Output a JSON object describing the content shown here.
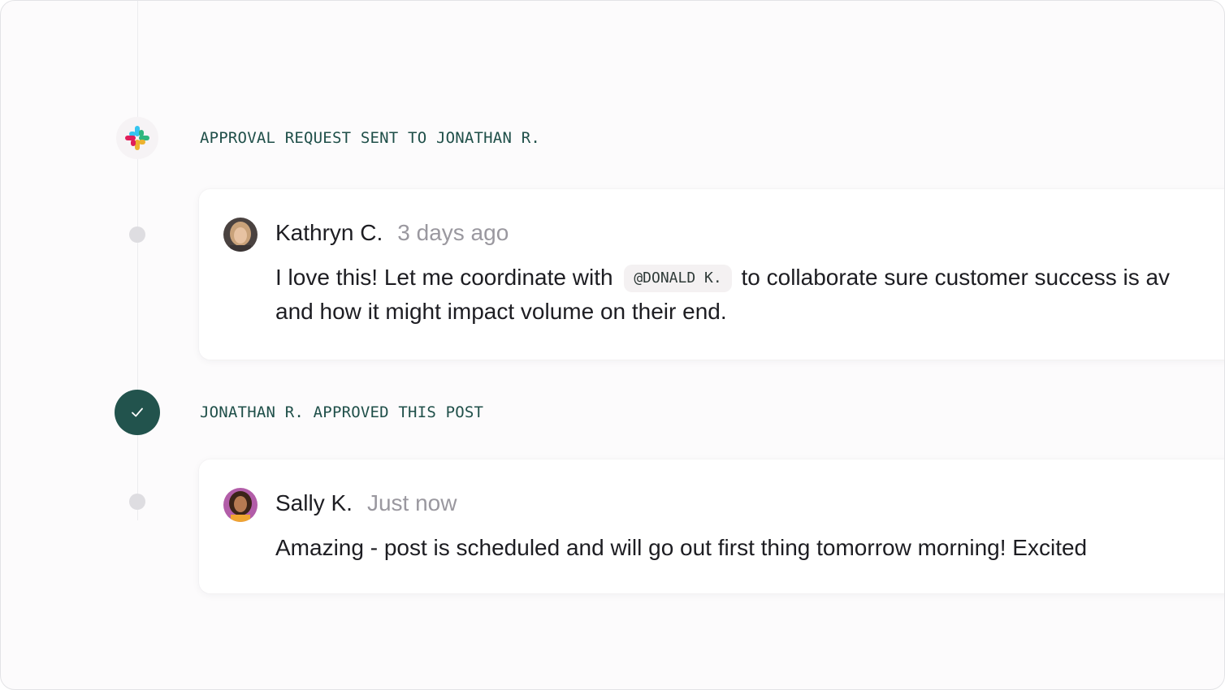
{
  "timeline": {
    "events": [
      {
        "label": "APPROVAL REQUEST SENT TO JONATHAN R.",
        "icon": "slack-icon"
      },
      {
        "label": "JONATHAN R. APPROVED THIS POST",
        "icon": "check-icon"
      }
    ],
    "comments": [
      {
        "author": "Kathryn C.",
        "timestamp": "3 days ago",
        "text_before": "I love this! Let me coordinate with",
        "mention": "@DONALD K.",
        "text_after": "to collaborate sure customer success is av",
        "text_line2": "and how it might impact volume on their end."
      },
      {
        "author": "Sally K.",
        "timestamp": "Just now",
        "text": "Amazing - post is scheduled and will go out first thing tomorrow morning! Excited"
      }
    ]
  },
  "colors": {
    "accent": "#22534d",
    "label_text": "#1f4f49",
    "muted_text": "#9a989f",
    "dot": "#dedde1"
  }
}
